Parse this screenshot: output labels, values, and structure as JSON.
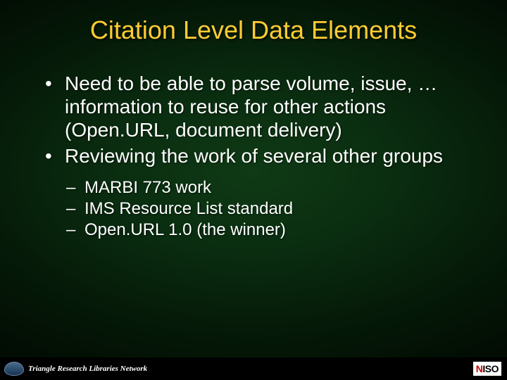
{
  "title": "Citation Level Data Elements",
  "bullets": {
    "b1": "Need to be able to parse volume, issue, … information to reuse for other actions (Open.URL, document delivery)",
    "b2": "Reviewing the work of several other groups",
    "sub1": "MARBI 773 work",
    "sub2": "IMS Resource List standard",
    "sub3": "Open.URL 1.0  (the winner)"
  },
  "footer": {
    "left_org": "Triangle Research Libraries Network",
    "right_n": "N",
    "right_iso": "ISO"
  }
}
